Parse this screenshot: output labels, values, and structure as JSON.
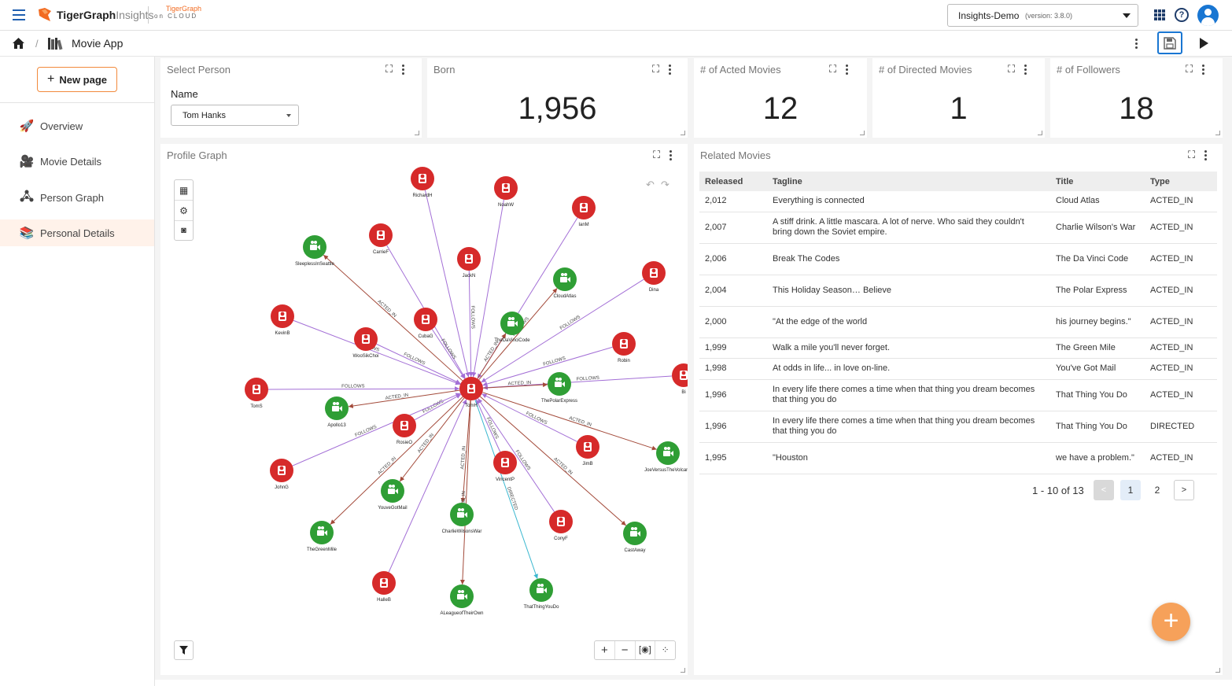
{
  "app": {
    "brand": "TigerGraph",
    "brand_suffix": "Insights",
    "cloud_top": "TigerGraph",
    "cloud_bottom": "on CLOUD"
  },
  "topbar": {
    "workspace": "Insights-Demo",
    "version": "(version: 3.8.0)"
  },
  "breadcrumb": {
    "separator": "/",
    "app_name": "Movie App"
  },
  "sidebar": {
    "new_page": "New page",
    "items": [
      {
        "label": "Overview",
        "icon": "rocket-icon"
      },
      {
        "label": "Movie Details",
        "icon": "movie-camera-icon"
      },
      {
        "label": "Person Graph",
        "icon": "graph-icon"
      },
      {
        "label": "Personal Details",
        "icon": "books-icon",
        "selected": true
      }
    ]
  },
  "select_person": {
    "title": "Select Person",
    "field_label": "Name",
    "value": "Tom Hanks"
  },
  "kpis": [
    {
      "title": "Born",
      "value": "1,956"
    },
    {
      "title": "# of Acted Movies",
      "value": "12"
    },
    {
      "title": "# of Directed Movies",
      "value": "1"
    },
    {
      "title": "# of Followers",
      "value": "18"
    }
  ],
  "profile_graph": {
    "title": "Profile Graph"
  },
  "graph": {
    "colors": {
      "person": "#d62a2a",
      "movie": "#2f9e35",
      "follows": "#a36fd6",
      "acted": "#a34a3a",
      "directed": "#3cb8d0"
    },
    "center": {
      "label": "TomH",
      "type": "person"
    },
    "nodes": [
      {
        "label": "RichardH",
        "type": "person"
      },
      {
        "label": "NoahW",
        "type": "person"
      },
      {
        "label": "IanM",
        "type": "person"
      },
      {
        "label": "SleeplessInSeattle",
        "type": "movie"
      },
      {
        "label": "CarrieF",
        "type": "person"
      },
      {
        "label": "JackN",
        "type": "person"
      },
      {
        "label": "CloudAtlas",
        "type": "movie"
      },
      {
        "label": "Dina",
        "type": "person"
      },
      {
        "label": "KevinB",
        "type": "person"
      },
      {
        "label": "CubaG",
        "type": "person"
      },
      {
        "label": "TheDaVinciCode",
        "type": "movie"
      },
      {
        "label": "WooSikChoi",
        "type": "person"
      },
      {
        "label": "Robin",
        "type": "person"
      },
      {
        "label": "Bi",
        "type": "person"
      },
      {
        "label": "ThePolarExpress",
        "type": "movie"
      },
      {
        "label": "TomS",
        "type": "person"
      },
      {
        "label": "Apollo13",
        "type": "movie"
      },
      {
        "label": "RosieO",
        "type": "person"
      },
      {
        "label": "JimB",
        "type": "person"
      },
      {
        "label": "JoeVersusTheVolcano",
        "type": "movie"
      },
      {
        "label": "JohnG",
        "type": "person"
      },
      {
        "label": "YouveGotMail",
        "type": "movie"
      },
      {
        "label": "VincentP",
        "type": "person"
      },
      {
        "label": "CharlieWilsonsWar",
        "type": "movie"
      },
      {
        "label": "TheGreenMile",
        "type": "movie"
      },
      {
        "label": "ConyF",
        "type": "person"
      },
      {
        "label": "CastAway",
        "type": "movie"
      },
      {
        "label": "HalleB",
        "type": "person"
      },
      {
        "label": "ALeagueofTheirOwn",
        "type": "movie"
      },
      {
        "label": "ThatThingYouDo",
        "type": "movie"
      }
    ],
    "edges": [
      {
        "to": 0,
        "kind": "follows"
      },
      {
        "to": 1,
        "kind": "follows"
      },
      {
        "to": 2,
        "kind": "follows"
      },
      {
        "to": 3,
        "kind": "acted",
        "label": "ACTED_IN"
      },
      {
        "to": 4,
        "kind": "follows"
      },
      {
        "to": 5,
        "kind": "follows",
        "label": "FOLLOWS"
      },
      {
        "to": 6,
        "kind": "acted",
        "label": "FOLLOWS"
      },
      {
        "to": 7,
        "kind": "follows",
        "label": "FOLLOWS"
      },
      {
        "to": 8,
        "kind": "follows",
        "label": "FOLLOWS"
      },
      {
        "to": 9,
        "kind": "follows",
        "label": "FOLLOWS"
      },
      {
        "to": 10,
        "kind": "acted",
        "label": "ACTED_IN"
      },
      {
        "to": 11,
        "kind": "follows",
        "label": "FOLLOWS"
      },
      {
        "to": 12,
        "kind": "follows",
        "label": "FOLLOWS"
      },
      {
        "to": 13,
        "kind": "follows",
        "label": "FOLLOWS"
      },
      {
        "to": 14,
        "kind": "acted",
        "label": "ACTED_IN"
      },
      {
        "to": 15,
        "kind": "follows",
        "label": "FOLLOWS"
      },
      {
        "to": 16,
        "kind": "acted",
        "label": "ACTED_IN"
      },
      {
        "to": 17,
        "kind": "follows",
        "label": "FOLLOWS"
      },
      {
        "to": 18,
        "kind": "follows",
        "label": "FOLLOWS"
      },
      {
        "to": 19,
        "kind": "acted",
        "label": "ACTED_IN"
      },
      {
        "to": 20,
        "kind": "follows",
        "label": "FOLLOWS"
      },
      {
        "to": 21,
        "kind": "acted",
        "label": "ACTED_IN"
      },
      {
        "to": 22,
        "kind": "follows",
        "label": "FOLLOWS"
      },
      {
        "to": 23,
        "kind": "acted",
        "label": "ACTED_IN"
      },
      {
        "to": 24,
        "kind": "acted",
        "label": "ACTED_IN"
      },
      {
        "to": 25,
        "kind": "follows",
        "label": "FOLLOWS"
      },
      {
        "to": 26,
        "kind": "acted",
        "label": "ACTED_IN"
      },
      {
        "to": 27,
        "kind": "follows"
      },
      {
        "to": 28,
        "kind": "acted",
        "label": "ACTED_IN"
      },
      {
        "to": 29,
        "kind": "directed",
        "label": "DIRECTED"
      }
    ]
  },
  "related_movies": {
    "title": "Related Movies",
    "columns": [
      "Released",
      "Tagline",
      "Title",
      "Type"
    ],
    "rows": [
      {
        "released": "2,012",
        "tagline": "Everything is connected",
        "title": "Cloud Atlas",
        "type": "ACTED_IN"
      },
      {
        "released": "2,007",
        "tagline": "A stiff drink. A little mascara. A lot of nerve. Who said they couldn't bring down the Soviet empire.",
        "title": "Charlie Wilson's War",
        "type": "ACTED_IN"
      },
      {
        "released": "2,006",
        "tagline": "Break The Codes",
        "title": "The Da Vinci Code",
        "type": "ACTED_IN"
      },
      {
        "released": "2,004",
        "tagline": "This Holiday Season… Believe",
        "title": "The Polar Express",
        "type": "ACTED_IN"
      },
      {
        "released": "2,000",
        "tagline": "\"At the edge of the world",
        "title": "his journey begins.\"",
        "type": "ACTED_IN"
      },
      {
        "released": "1,999",
        "tagline": "Walk a mile you'll never forget.",
        "title": "The Green Mile",
        "type": "ACTED_IN"
      },
      {
        "released": "1,998",
        "tagline": "At odds in life... in love on-line.",
        "title": "You've Got Mail",
        "type": "ACTED_IN"
      },
      {
        "released": "1,996",
        "tagline": "In every life there comes a time when that thing you dream becomes that thing you do",
        "title": "That Thing You Do",
        "type": "ACTED_IN"
      },
      {
        "released": "1,996",
        "tagline": "In every life there comes a time when that thing you dream becomes that thing you do",
        "title": "That Thing You Do",
        "type": "DIRECTED"
      },
      {
        "released": "1,995",
        "tagline": "\"Houston",
        "title": "we have a problem.\"",
        "type": "ACTED_IN"
      }
    ],
    "pagination": {
      "range": "1 - 10 of 13",
      "prev": "<",
      "page1": "1",
      "page2": "2",
      "next": ">"
    }
  },
  "fab": {
    "label": "+"
  }
}
